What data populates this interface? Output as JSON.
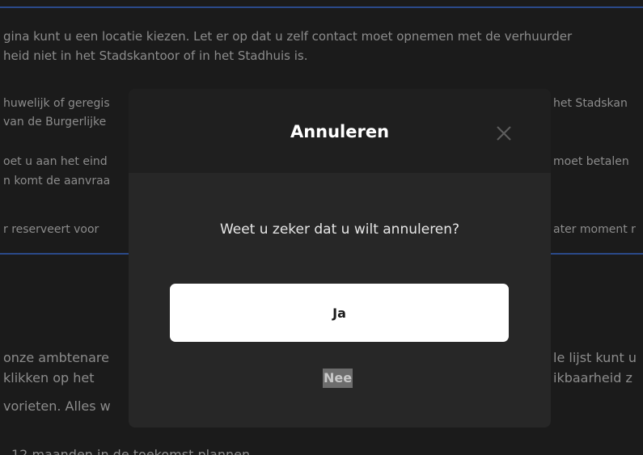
{
  "background": {
    "lines_full": [
      "gina kunt u een locatie kiezen. Let er op dat u zelf contact moet opnemen met de verhuurder",
      "heid niet in het Stadskantoor of in het Stadhuis is."
    ],
    "left_fragments": [
      "huwelijk of geregis",
      "van de Burgerlijke",
      "oet u aan het eind",
      "n komt de aanvraa",
      "r reserveert voor",
      "onze ambtenare",
      "klikken op het",
      "vorieten. Alles w",
      "12 maanden in de toekomst plannen"
    ],
    "right_fragments": [
      "het Stadskan",
      "moet betalen",
      "ater moment r",
      "le lijst kunt u",
      "ikbaarheid z"
    ]
  },
  "modal": {
    "title": "Annuleren",
    "close_icon": "close-icon",
    "message": "Weet u zeker dat u wilt annuleren?",
    "yes_label": "Ja",
    "no_label": "Nee"
  },
  "colors": {
    "accent_rule": "#2b4a8a",
    "modal_bg": "#272727",
    "header_bg": "#1f1f1f",
    "button_bg": "#ffffff"
  }
}
